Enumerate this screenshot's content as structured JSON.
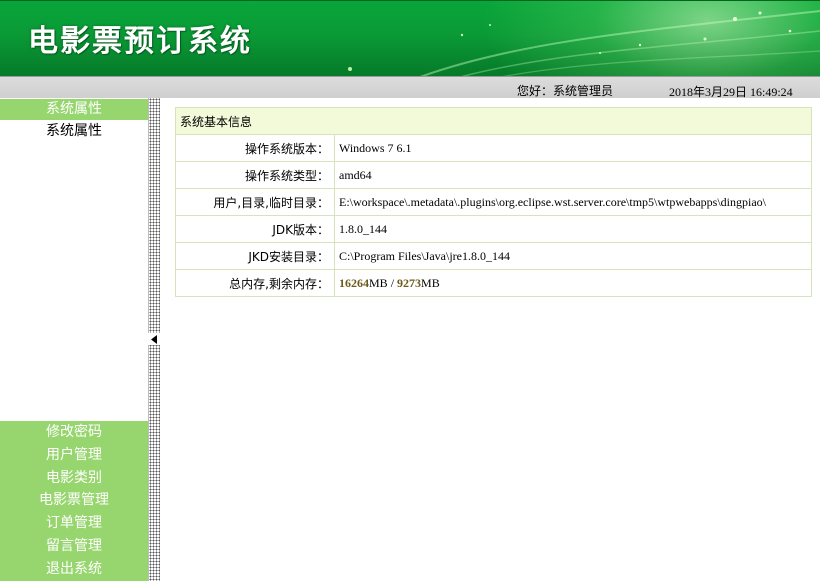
{
  "header": {
    "title": "电影票预订系统"
  },
  "status": {
    "greeting": "您好：系统管理员",
    "datetime": "2018年3月29日 16:49:24"
  },
  "sidebar": {
    "section_title": "系统属性",
    "active_item": "系统属性",
    "menu": [
      {
        "label": "修改密码"
      },
      {
        "label": "用户管理"
      },
      {
        "label": "电影类别"
      },
      {
        "label": "电影票管理"
      },
      {
        "label": "订单管理"
      },
      {
        "label": "留言管理"
      },
      {
        "label": "退出系统"
      }
    ]
  },
  "info_table": {
    "heading": "系统基本信息",
    "rows": [
      {
        "label": "操作系统版本：",
        "value": "Windows 7  6.1"
      },
      {
        "label": "操作系统类型：",
        "value": "amd64"
      },
      {
        "label": "用户,目录,临时目录：",
        "value": "E:\\workspace\\.metadata\\.plugins\\org.eclipse.wst.server.core\\tmp5\\wtpwebapps\\dingpiao\\"
      },
      {
        "label": "JDK版本：",
        "value": "1.8.0_144"
      },
      {
        "label": "JKD安装目录：",
        "value": "C:\\Program Files\\Java\\jre1.8.0_144"
      }
    ],
    "memory": {
      "label": "总内存,剩余内存：",
      "total": "16264",
      "total_unit": "MB",
      "separator": " / ",
      "free": "9273",
      "free_unit": "MB"
    }
  },
  "colors": {
    "banner_green": "#0a9a36",
    "menu_green": "#97d66f",
    "table_header_bg": "#f2fad9"
  }
}
